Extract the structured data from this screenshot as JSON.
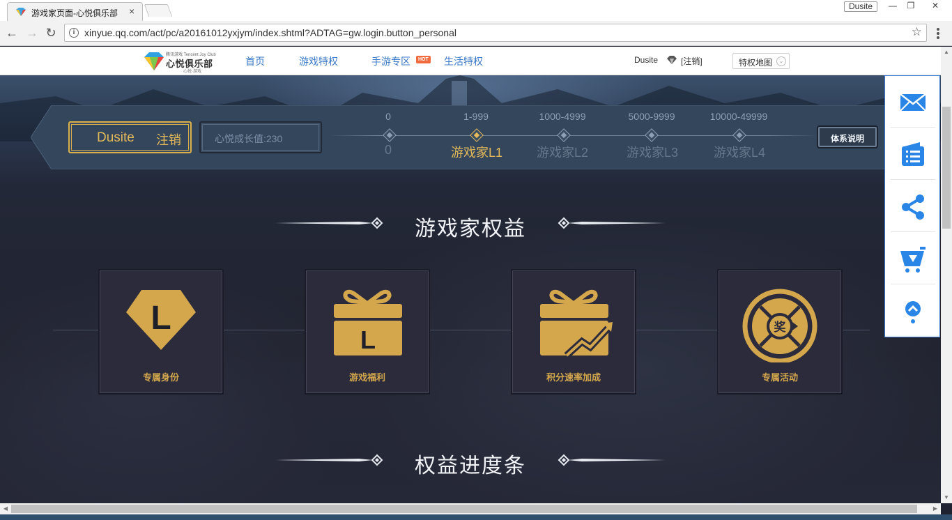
{
  "browser": {
    "tab_title": "游戏家页面-心悦俱乐部",
    "tab_close": "×",
    "profile_name": "Dusite",
    "window_min": "—",
    "window_restore": "❐",
    "window_close": "✕",
    "back": "←",
    "forward": "→",
    "reload": "↻",
    "url": "xinyue.qq.com/act/pc/a20161012yxjym/index.shtml?ADTAG=gw.login.button_personal",
    "info_icon_glyph": "i",
    "star_glyph": "☆"
  },
  "header": {
    "logo_text": "心悦俱乐部",
    "logo_small": "腾讯游戏 Tencent Joy Club",
    "logo_sub": "心悦·游戏",
    "nav": [
      {
        "label": "首页"
      },
      {
        "label": "游戏特权"
      },
      {
        "label": "手游专区"
      },
      {
        "label": "生活特权"
      }
    ],
    "hot_badge": "HOT",
    "username": "Dusite",
    "logout": "[注销]",
    "map_select": "特权地图",
    "select_arrow": "⌄"
  },
  "level_bar": {
    "username": "Dusite",
    "logout": "注销",
    "growth": "心悦成长值:230",
    "levels": [
      {
        "range": "0",
        "name": "0",
        "active": false
      },
      {
        "range": "1-999",
        "name": "游戏家L1",
        "active": true
      },
      {
        "range": "1000-4999",
        "name": "游戏家L2",
        "active": false
      },
      {
        "range": "5000-9999",
        "name": "游戏家L3",
        "active": false
      },
      {
        "range": "10000-49999",
        "name": "游戏家L4",
        "active": false
      }
    ],
    "explain_button": "体系说明"
  },
  "sections": {
    "benefits_title": "游戏家权益",
    "progress_title": "权益进度条"
  },
  "benefits": [
    {
      "label": "专属身份",
      "icon": "diamond-l-icon",
      "icon_text": "L"
    },
    {
      "label": "游戏福利",
      "icon": "gift-l-icon",
      "icon_text": "L"
    },
    {
      "label": "积分速率加成",
      "icon": "gift-growth-icon"
    },
    {
      "label": "专属活动",
      "icon": "prize-wheel-icon",
      "icon_text": "奖"
    }
  ],
  "side_panel": [
    {
      "icon": "mail-icon"
    },
    {
      "icon": "list-icon"
    },
    {
      "icon": "share-icon"
    },
    {
      "icon": "cart-icon"
    },
    {
      "icon": "back-to-top-icon"
    }
  ],
  "colors": {
    "gold": "#e3b95a",
    "card_gold": "#d4a74c",
    "link_blue": "#3b7bc8",
    "side_blue": "#3b7bd4"
  }
}
